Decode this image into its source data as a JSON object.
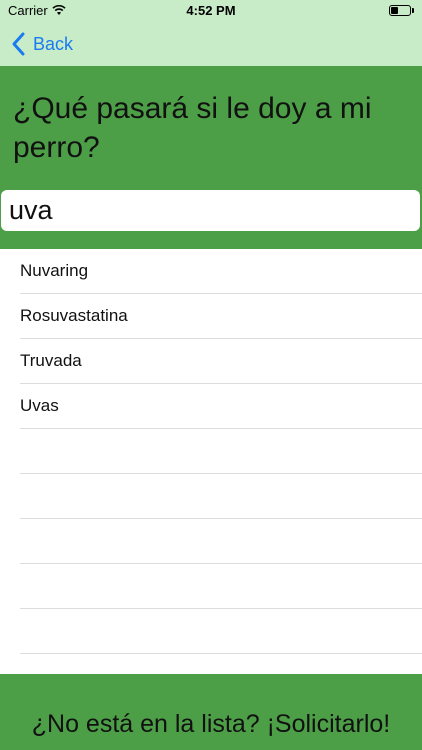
{
  "status_bar": {
    "carrier": "Carrier",
    "time": "4:52 PM",
    "icons": [
      "wifi-icon",
      "battery-icon"
    ]
  },
  "nav": {
    "back_label": "Back",
    "back_icon": "chevron-left-icon",
    "accent_color": "#1a7cf0"
  },
  "header": {
    "question": "¿Qué pasará si le doy a mi perro?",
    "search_value": "uva",
    "background_color": "#4d9f47"
  },
  "results": [
    {
      "label": "Nuvaring"
    },
    {
      "label": "Rosuvastatina"
    },
    {
      "label": "Truvada"
    },
    {
      "label": "Uvas"
    }
  ],
  "footer": {
    "request_label": "¿No está en la lista? ¡Solicitarlo!"
  }
}
